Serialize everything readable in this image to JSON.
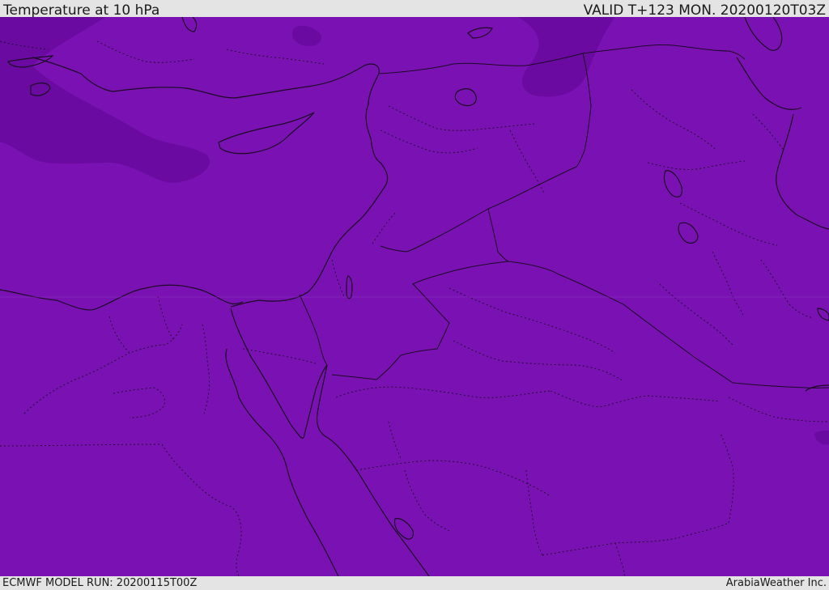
{
  "header": {
    "title": "Temperature at 10 hPa",
    "valid": "VALID T+123 MON. 20200120T03Z"
  },
  "footer": {
    "model_run": "ECMWF MODEL RUN: 20200115T00Z",
    "credit": "ArabiaWeather Inc."
  },
  "map": {
    "fill_color": "#7a12b3",
    "cold_pocket_color": "#6a0aa0",
    "cold_core_color": "#5c0696",
    "coastline_color": "#1a0a22",
    "border_color": "#1a0a22"
  }
}
